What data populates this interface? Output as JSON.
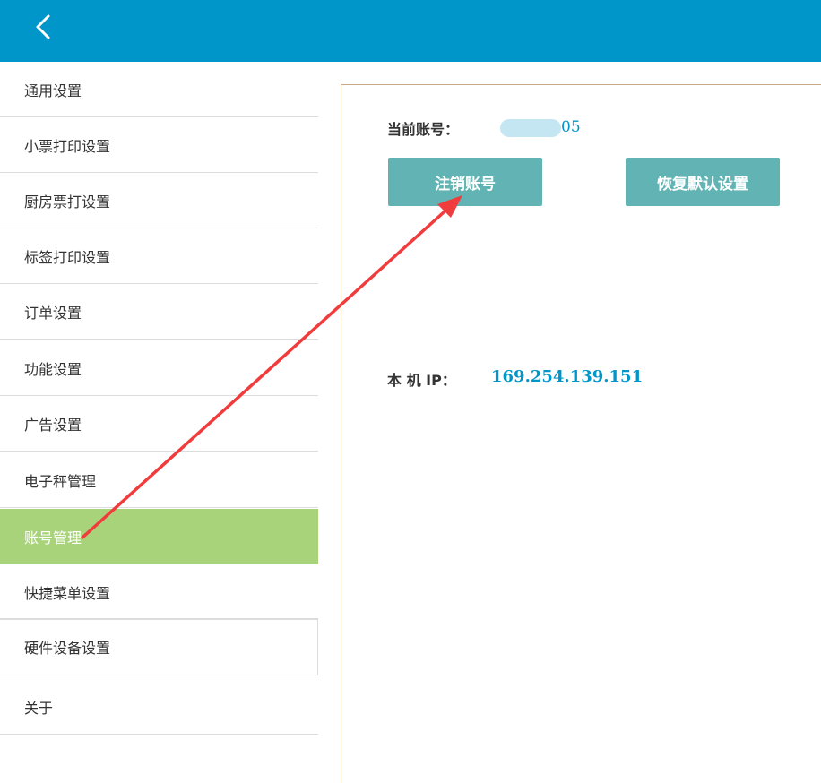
{
  "header": {
    "back_icon": "chevron-left-icon"
  },
  "sidebar": {
    "items": [
      {
        "label": "通用设置"
      },
      {
        "label": "小票打印设置"
      },
      {
        "label": "厨房票打设置"
      },
      {
        "label": "标签打印设置"
      },
      {
        "label": "订单设置"
      },
      {
        "label": "功能设置"
      },
      {
        "label": "广告设置"
      },
      {
        "label": "电子秤管理"
      },
      {
        "label": "账号管理"
      },
      {
        "label": "快捷菜单设置"
      },
      {
        "label": "硬件设备设置"
      },
      {
        "label": "关于"
      }
    ],
    "active_index": 8
  },
  "account": {
    "label": "当前账号：",
    "value_visible": "05",
    "logout_button": "注销账号",
    "reset_button": "恢复默认设置"
  },
  "network": {
    "ip_label": "本 机 IP：",
    "ip_value": "169.254.139.151"
  },
  "colors": {
    "header": "#0096c9",
    "active_item": "#a8d37a",
    "button": "#61b4b3",
    "accent_text": "#0096c9",
    "arrow": "#f03c3c"
  }
}
